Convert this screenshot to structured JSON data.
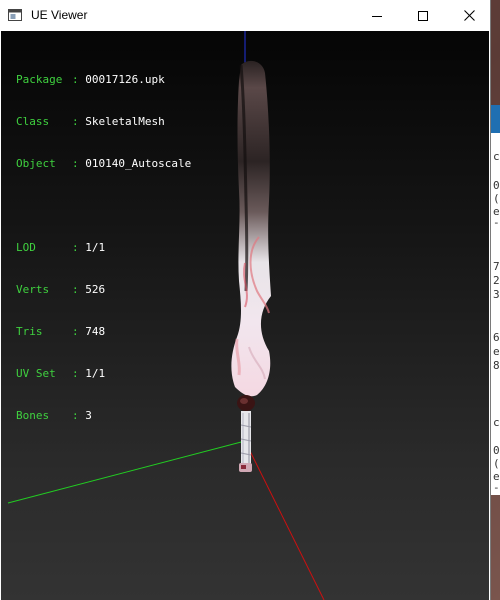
{
  "window": {
    "title": "UE Viewer",
    "controls": {
      "minimize": "minimize",
      "maximize": "maximize",
      "close": "close"
    }
  },
  "info": {
    "package_label": "Package",
    "package_value": "00017126.upk",
    "class_label": "Class",
    "class_value": "SkeletalMesh",
    "object_label": "Object",
    "object_value": "010140_Autoscale",
    "lod_label": "LOD",
    "lod_value": "1/1",
    "verts_label": "Verts",
    "verts_value": "526",
    "tris_label": "Tris",
    "tris_value": "748",
    "uvset_label": "UV Set",
    "uvset_value": "1/1",
    "bones_label": "Bones",
    "bones_value": "3",
    "separator": ":"
  },
  "colors": {
    "label_green": "#3fd13f",
    "value_white": "#ffffff",
    "axis_x": "#cc1010",
    "axis_y": "#22cc22",
    "axis_z": "#2233dd"
  },
  "side_window": {
    "glyphs": [
      "c",
      "0",
      "(",
      "e",
      "-",
      "7",
      "2",
      "3",
      "6",
      "e",
      "8",
      "c",
      "0",
      "(",
      "e",
      "-"
    ]
  }
}
